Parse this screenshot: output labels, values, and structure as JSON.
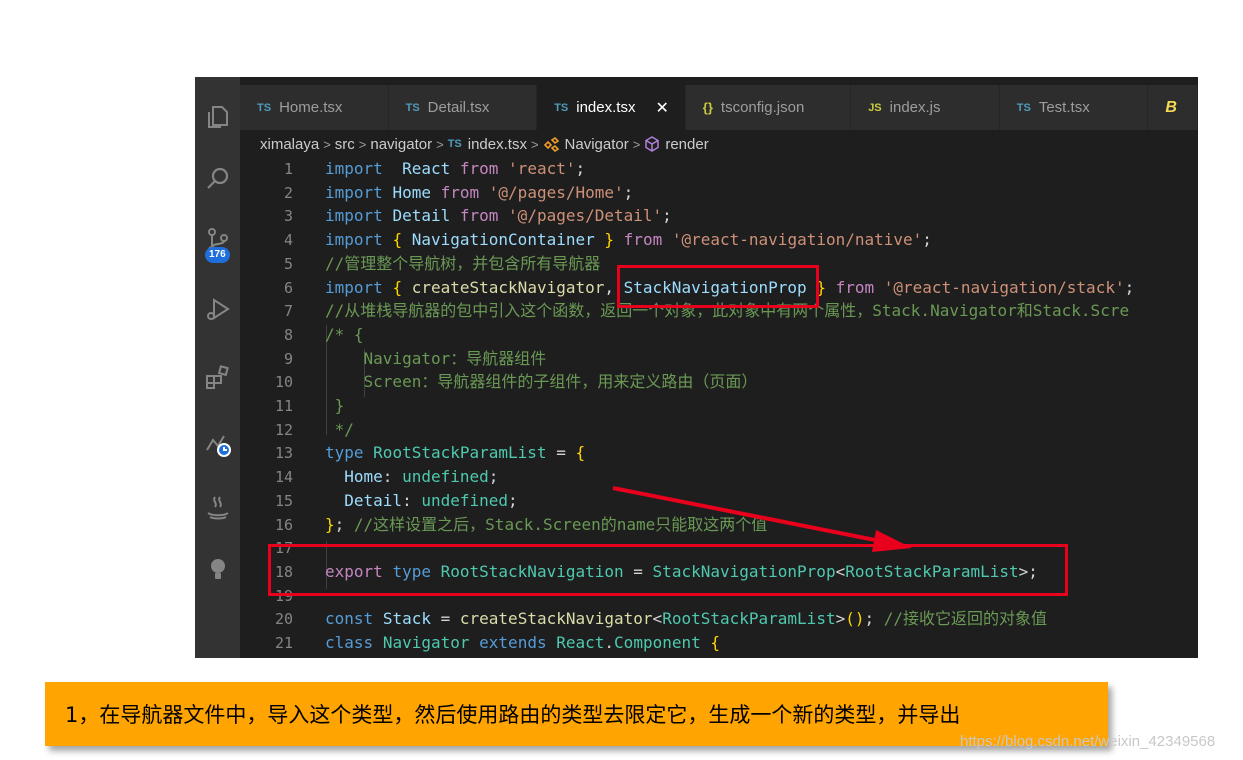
{
  "tabs": [
    {
      "icon": "TS",
      "label": "Home.tsx",
      "kind": "ts"
    },
    {
      "icon": "TS",
      "label": "Detail.tsx",
      "kind": "ts"
    },
    {
      "icon": "TS",
      "label": "index.tsx",
      "kind": "ts",
      "active": true
    },
    {
      "icon": "{}",
      "label": "tsconfig.json",
      "kind": "json"
    },
    {
      "icon": "JS",
      "label": "index.js",
      "kind": "js"
    },
    {
      "icon": "TS",
      "label": "Test.tsx",
      "kind": "ts"
    },
    {
      "icon": "B",
      "label": "",
      "kind": "babel"
    }
  ],
  "close_glyph": "✕",
  "activity_badge": "176",
  "breadcrumb": {
    "root": "ximalaya",
    "folder1": "src",
    "folder2": "navigator",
    "file_icon": "TS",
    "file": "index.tsx",
    "symbol1": "Navigator",
    "symbol2": "render"
  },
  "code_lines": [
    {
      "n": "1",
      "t": [
        [
          "kw",
          "import"
        ],
        [
          "",
          "  "
        ],
        [
          "vr",
          "React"
        ],
        [
          "",
          " "
        ],
        [
          "kc",
          "from"
        ],
        [
          "",
          " "
        ],
        [
          "st",
          "'react'"
        ],
        [
          "",
          ";"
        ]
      ]
    },
    {
      "n": "2",
      "t": [
        [
          "kw",
          "import"
        ],
        [
          "",
          " "
        ],
        [
          "vr",
          "Home"
        ],
        [
          "",
          " "
        ],
        [
          "kc",
          "from"
        ],
        [
          "",
          " "
        ],
        [
          "st",
          "'@/pages/Home'"
        ],
        [
          "",
          ";"
        ]
      ]
    },
    {
      "n": "3",
      "t": [
        [
          "kw",
          "import"
        ],
        [
          "",
          " "
        ],
        [
          "vr",
          "Detail"
        ],
        [
          "",
          " "
        ],
        [
          "kc",
          "from"
        ],
        [
          "",
          " "
        ],
        [
          "st",
          "'@/pages/Detail'"
        ],
        [
          "",
          ";"
        ]
      ]
    },
    {
      "n": "4",
      "t": [
        [
          "kw",
          "import"
        ],
        [
          "",
          " "
        ],
        [
          "br",
          "{"
        ],
        [
          "",
          " "
        ],
        [
          "vr",
          "NavigationContainer"
        ],
        [
          "",
          " "
        ],
        [
          "br",
          "}"
        ],
        [
          "",
          " "
        ],
        [
          "kc",
          "from"
        ],
        [
          "",
          " "
        ],
        [
          "st",
          "'@react-navigation/native'"
        ],
        [
          "",
          ";"
        ]
      ]
    },
    {
      "n": "5",
      "t": [
        [
          "cm",
          "//管理整个导航树，并包含所有导航器"
        ]
      ]
    },
    {
      "n": "6",
      "t": [
        [
          "kw",
          "import"
        ],
        [
          "",
          " "
        ],
        [
          "br",
          "{"
        ],
        [
          "",
          " "
        ],
        [
          "fn",
          "createStackNavigator"
        ],
        [
          "",
          ", "
        ],
        [
          "vr",
          "StackNavigationProp"
        ],
        [
          "",
          " "
        ],
        [
          "br",
          "}"
        ],
        [
          "",
          " "
        ],
        [
          "kc",
          "from"
        ],
        [
          "",
          " "
        ],
        [
          "st",
          "'@react-navigation/stack'"
        ],
        [
          "",
          ";"
        ]
      ]
    },
    {
      "n": "7",
      "t": [
        [
          "cm",
          "//从堆栈导航器的包中引入这个函数，返回一个对象，此对象中有两个属性，Stack.Navigator和Stack.Scre"
        ]
      ]
    },
    {
      "n": "8",
      "t": [
        [
          "cm",
          "/* {"
        ]
      ]
    },
    {
      "n": "9",
      "t": [
        [
          "cm",
          "    Navigator：导航器组件"
        ]
      ]
    },
    {
      "n": "10",
      "t": [
        [
          "cm",
          "    Screen：导航器组件的子组件，用来定义路由（页面）"
        ]
      ]
    },
    {
      "n": "11",
      "t": [
        [
          "cm",
          " }"
        ]
      ]
    },
    {
      "n": "12",
      "t": [
        [
          "cm",
          " */"
        ]
      ]
    },
    {
      "n": "13",
      "t": [
        [
          "kw",
          "type"
        ],
        [
          "",
          " "
        ],
        [
          "ty",
          "RootStackParamList"
        ],
        [
          "",
          " = "
        ],
        [
          "br",
          "{"
        ]
      ]
    },
    {
      "n": "14",
      "t": [
        [
          "",
          "  "
        ],
        [
          "vr",
          "Home"
        ],
        [
          "",
          ": "
        ],
        [
          "ty",
          "undefined"
        ],
        [
          "",
          ";"
        ]
      ]
    },
    {
      "n": "15",
      "t": [
        [
          "",
          "  "
        ],
        [
          "vr",
          "Detail"
        ],
        [
          "",
          ": "
        ],
        [
          "ty",
          "undefined"
        ],
        [
          "",
          ";"
        ]
      ]
    },
    {
      "n": "16",
      "t": [
        [
          "br",
          "}"
        ],
        [
          "",
          "; "
        ],
        [
          "cm",
          "//这样设置之后，Stack.Screen的name只能取这两个值"
        ]
      ]
    },
    {
      "n": "17",
      "t": []
    },
    {
      "n": "18",
      "t": [
        [
          "kc",
          "export"
        ],
        [
          "",
          " "
        ],
        [
          "kw",
          "type"
        ],
        [
          "",
          " "
        ],
        [
          "ty",
          "RootStackNavigation"
        ],
        [
          "",
          " = "
        ],
        [
          "ty",
          "StackNavigationProp"
        ],
        [
          "",
          "<"
        ],
        [
          "ty",
          "RootStackParamList"
        ],
        [
          "",
          ">;"
        ]
      ]
    },
    {
      "n": "19",
      "t": []
    },
    {
      "n": "20",
      "t": [
        [
          "kw",
          "const"
        ],
        [
          "",
          " "
        ],
        [
          "vr",
          "Stack"
        ],
        [
          "",
          " = "
        ],
        [
          "fn",
          "createStackNavigator"
        ],
        [
          "",
          "<"
        ],
        [
          "ty",
          "RootStackParamList"
        ],
        [
          "",
          ">"
        ],
        [
          "br",
          "()"
        ],
        [
          "",
          "; "
        ],
        [
          "cm",
          "//接收它返回的对象值"
        ]
      ]
    },
    {
      "n": "21",
      "t": [
        [
          "kw",
          "class"
        ],
        [
          "",
          " "
        ],
        [
          "ty",
          "Navigator"
        ],
        [
          "",
          " "
        ],
        [
          "kw",
          "extends"
        ],
        [
          "",
          " "
        ],
        [
          "ty",
          "React"
        ],
        [
          "",
          "."
        ],
        [
          "ty",
          "Component"
        ],
        [
          "",
          " "
        ],
        [
          "br",
          "{"
        ]
      ]
    }
  ],
  "caption": "1，在导航器文件中，导入这个类型，然后使用路由的类型去限定它，生成一个新的类型，并导出",
  "watermark": "https://blog.csdn.net/weixin_42349568",
  "colors": {
    "editor_bg": "#1e1e1e",
    "highlight_red": "#e8001c",
    "caption_bg": "#ffa400"
  }
}
